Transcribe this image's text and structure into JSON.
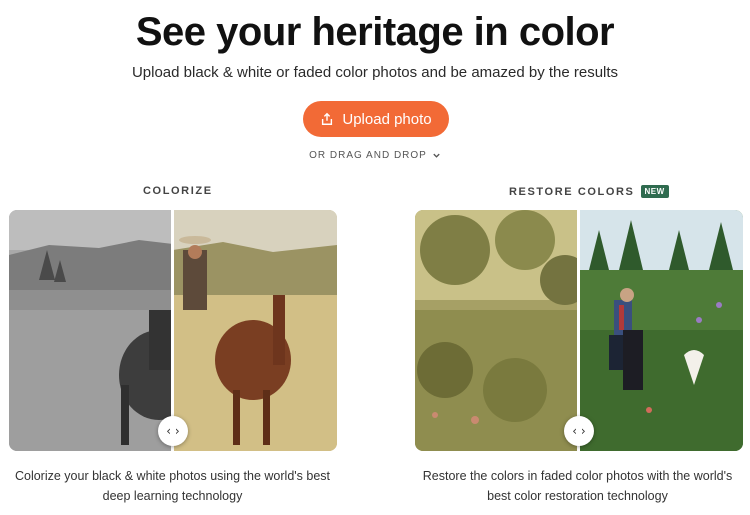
{
  "header": {
    "title": "See your heritage in color",
    "subtitle": "Upload black & white or faded color photos and be amazed by the results"
  },
  "upload": {
    "button_label": "Upload photo",
    "button_icon": "upload-icon",
    "drag_label": "OR DRAG AND DROP",
    "drag_icon": "chevron-down-icon",
    "accent_color": "#f26a36"
  },
  "colorize": {
    "label": "COLORIZE",
    "caption_line1": "Colorize your black & white photos using the world's best",
    "caption_line2": "deep learning technology",
    "handle_glyph": "‹ ›"
  },
  "restore": {
    "label": "RESTORE COLORS",
    "badge": "NEW",
    "badge_color": "#2f6b4f",
    "caption_line1": "Restore the colors in faded color photos with the world's",
    "caption_line2": "best color restoration technology",
    "handle_glyph": "‹ ›"
  }
}
